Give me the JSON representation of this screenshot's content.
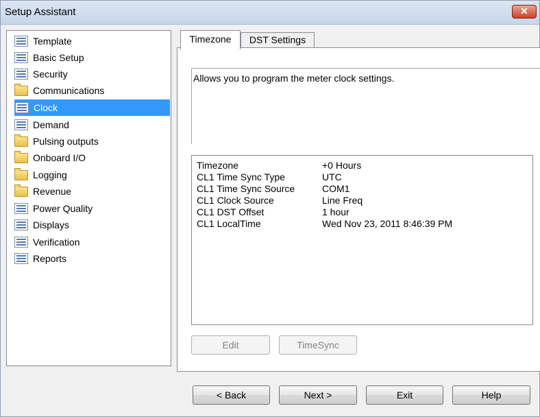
{
  "window": {
    "title": "Setup Assistant",
    "close_glyph": "✕"
  },
  "tree": {
    "items": [
      {
        "label": "Template",
        "icon": "doc"
      },
      {
        "label": "Basic Setup",
        "icon": "doc"
      },
      {
        "label": "Security",
        "icon": "doc"
      },
      {
        "label": "Communications",
        "icon": "folder"
      },
      {
        "label": "Clock",
        "icon": "doc",
        "selected": true
      },
      {
        "label": "Demand",
        "icon": "doc"
      },
      {
        "label": "Pulsing outputs",
        "icon": "folder"
      },
      {
        "label": "Onboard I/O",
        "icon": "folder"
      },
      {
        "label": "Logging",
        "icon": "folder"
      },
      {
        "label": "Revenue",
        "icon": "folder"
      },
      {
        "label": "Power Quality",
        "icon": "doc"
      },
      {
        "label": "Displays",
        "icon": "doc"
      },
      {
        "label": "Verification",
        "icon": "doc"
      },
      {
        "label": "Reports",
        "icon": "doc"
      }
    ]
  },
  "tabs": [
    {
      "label": "Timezone",
      "active": true
    },
    {
      "label": "DST Settings",
      "active": false
    }
  ],
  "description": "Allows you to program the meter clock settings.",
  "settings": [
    {
      "name": "Timezone",
      "value": "+0 Hours"
    },
    {
      "name": "CL1 Time Sync Type",
      "value": "UTC"
    },
    {
      "name": "CL1 Time Sync Source",
      "value": "COM1"
    },
    {
      "name": "CL1 Clock Source",
      "value": "Line Freq"
    },
    {
      "name": "CL1 DST Offset",
      "value": "1 hour"
    },
    {
      "name": "CL1 LocalTime",
      "value": "Wed Nov 23, 2011 8:46:39 PM"
    }
  ],
  "panel_buttons": {
    "edit": "Edit",
    "timesync": "TimeSync"
  },
  "footer_buttons": {
    "back": "< Back",
    "next": "Next >",
    "exit": "Exit",
    "help": "Help"
  },
  "colors": {
    "selection": "#3399ff",
    "titlebar": "#c6d6ea",
    "close": "#c7432a"
  }
}
